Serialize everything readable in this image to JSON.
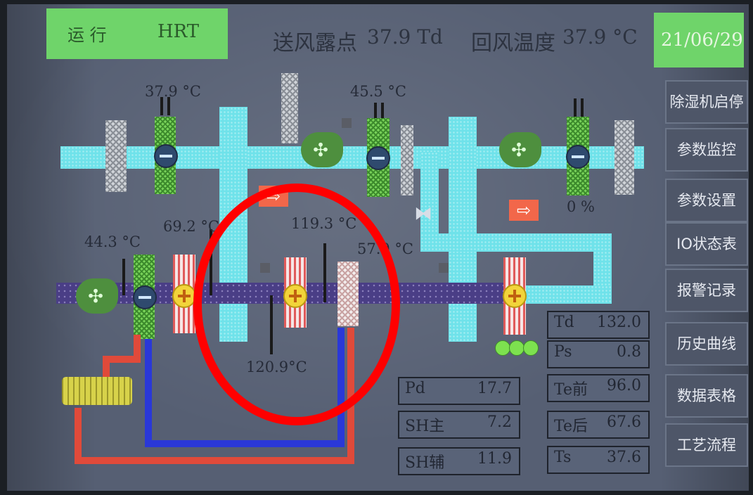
{
  "header": {
    "status_run": "运 行",
    "status_mode": "HRT",
    "supply_dewpoint_label": "送风露点",
    "supply_dewpoint_value": "37.9 Td",
    "return_temp_label": "回风温度",
    "return_temp_value": "37.9 °C",
    "date": "21/06/29"
  },
  "menu": {
    "items": [
      {
        "label": "除湿机启停"
      },
      {
        "label": "参数监控"
      },
      {
        "label": "参数设置"
      },
      {
        "label": "IO状态表"
      },
      {
        "label": "报警记录"
      },
      {
        "label": "历史曲线"
      },
      {
        "label": "数据表格"
      },
      {
        "label": "工艺流程"
      }
    ]
  },
  "readings": {
    "t1": "37.9 °C",
    "t2": "45.5 °C",
    "t3": "44.3 °C",
    "t4": "69.2 °C",
    "t5": "119.3 °C",
    "t6": "57.0 °C",
    "t7": "120.9°C",
    "percent": "0 %"
  },
  "panel": {
    "pd": {
      "label": "Pd",
      "value": "17.7"
    },
    "sh_main": {
      "label": "SH主",
      "value": "7.2"
    },
    "sh_aux": {
      "label": "SH辅",
      "value": "11.9"
    },
    "td": {
      "label": "Td",
      "value": "132.0"
    },
    "ps": {
      "label": "Ps",
      "value": "0.8"
    },
    "te_before": {
      "label": "Te前",
      "value": "96.0"
    },
    "te_after": {
      "label": "Te后",
      "value": "67.6"
    },
    "ts": {
      "label": "Ts",
      "value": "37.6"
    }
  },
  "colors": {
    "accent_green": "#6fd46a",
    "duct_cyan": "#6fe2ea",
    "duct_purple": "#4a3e86",
    "annotation_red": "#ff0000"
  }
}
